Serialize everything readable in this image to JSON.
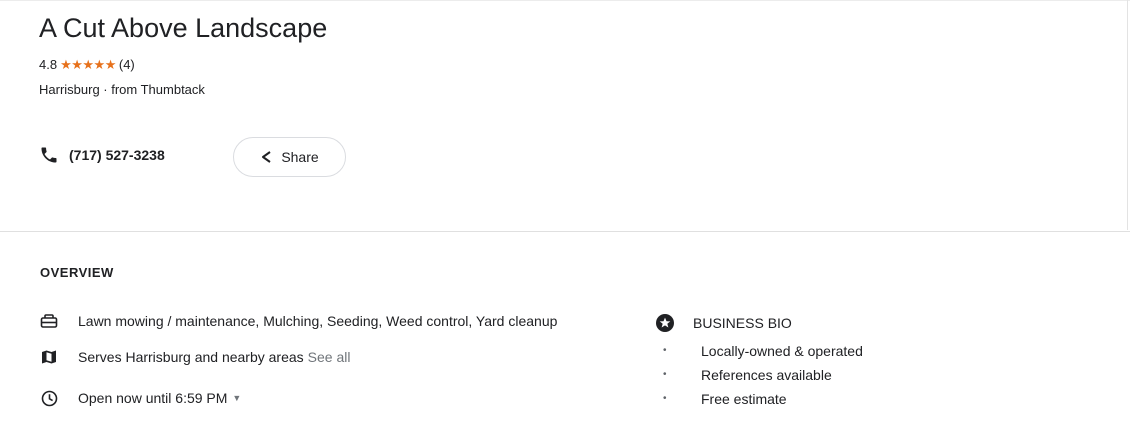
{
  "business": {
    "name": "A Cut Above Landscape",
    "rating": "4.8",
    "stars": "★★★★★",
    "review_count": "(4)",
    "location_line": "Harrisburg · from Thumbtack"
  },
  "actions": {
    "phone": "(717) 527-3238",
    "share_label": "Share"
  },
  "overview": {
    "heading": "OVERVIEW",
    "services": "Lawn mowing / maintenance, Mulching, Seeding, Weed control, Yard cleanup",
    "area_text": "Serves Harrisburg and nearby areas",
    "area_link": "See all",
    "hours_text": "Open now until 6:59 PM",
    "hours_caret": "▼"
  },
  "bio": {
    "heading": "BUSINESS BIO",
    "items": [
      "Locally-owned & operated",
      "References available",
      "Free estimate"
    ]
  },
  "colors": {
    "stars": "#e7711b",
    "text": "#202124",
    "muted": "#70757a"
  },
  "icons": [
    "phone-icon",
    "share-icon",
    "toolbox-icon",
    "map-icon",
    "clock-icon",
    "star-badge-icon"
  ]
}
